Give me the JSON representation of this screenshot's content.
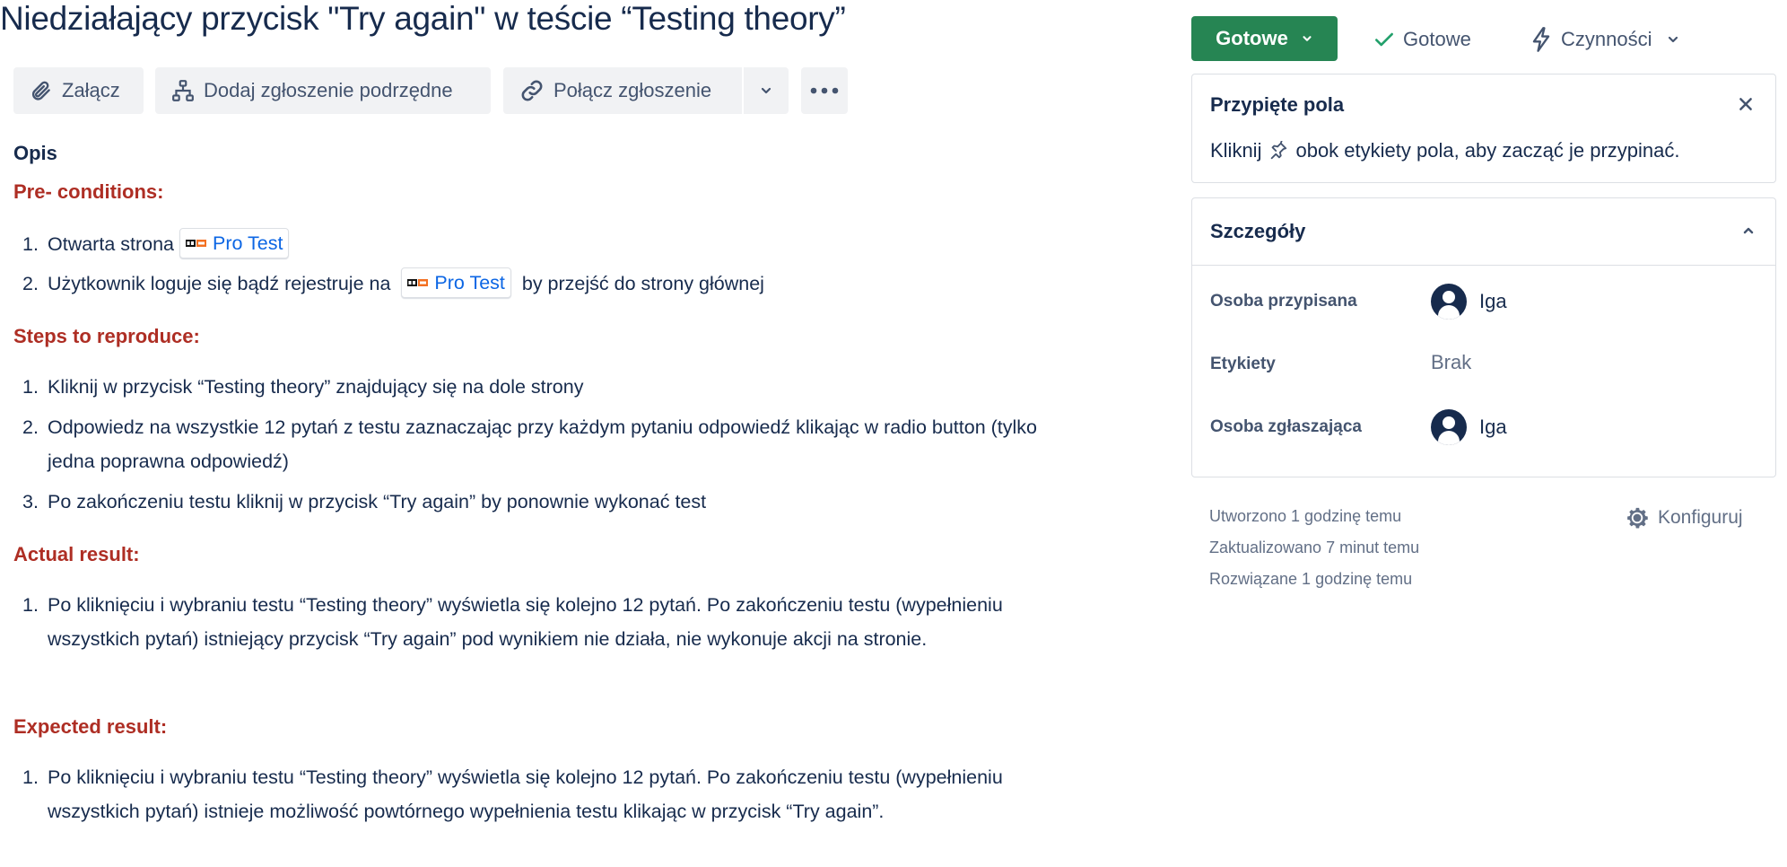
{
  "issue": {
    "title": "Niedziałający przycisk \"Try again\" w teście “Testing theory”"
  },
  "toolbar": {
    "attach_label": "Załącz",
    "add_child_label": "Dodaj zgłoszenie podrzędne",
    "link_issue_label": "Połącz zgłoszenie"
  },
  "description": {
    "heading": "Opis",
    "preconditions": {
      "heading": "Pre- conditions:",
      "items": [
        {
          "num": "1.",
          "before": "Otwarta strona",
          "link": "Pro Test",
          "after": ""
        },
        {
          "num": "2.",
          "before": "Użytkownik loguje się bądź rejestruje na",
          "link": "Pro Test",
          "after": "by przejść do strony głównej"
        }
      ]
    },
    "steps": {
      "heading": "Steps to reproduce:",
      "items": [
        {
          "num": "1.",
          "text": "Kliknij w przycisk “Testing theory” znajdujący się na dole strony"
        },
        {
          "num": "2.",
          "text": "Odpowiedz na wszystkie 12 pytań z testu zaznaczając przy każdym pytaniu odpowiedź klikając w radio button (tylko jedna poprawna odpowiedź)"
        },
        {
          "num": "3.",
          "text": "Po zakończeniu testu kliknij w przycisk “Try again” by ponownie wykonać test"
        }
      ]
    },
    "actual": {
      "heading": "Actual result:",
      "items": [
        {
          "num": "1.",
          "text": "Po kliknięciu i wybraniu testu “Testing theory” wyświetla się kolejno 12 pytań. Po zakończeniu testu (wypełnieniu wszystkich pytań) istniejący przycisk “Try again” pod wynikiem nie działa, nie wykonuje akcji na stronie."
        }
      ]
    },
    "expected": {
      "heading": "Expected result:",
      "items": [
        {
          "num": "1.",
          "text": "Po kliknięciu i wybraniu testu “Testing theory” wyświetla się kolejno 12 pytań. Po zakończeniu testu (wypełnieniu wszystkich pytań) istnieje możliwość powtórnego wypełnienia testu klikając w przycisk “Try again”."
        }
      ]
    }
  },
  "status_bar": {
    "status_button": "Gotowe",
    "resolution": "Gotowe",
    "actions": "Czynności"
  },
  "pinned": {
    "title": "Przypięte pola",
    "hint_before": "Kliknij",
    "hint_after": "obok etykiety pola, aby zacząć je przypinać."
  },
  "details": {
    "title": "Szczegóły",
    "fields": [
      {
        "label": "Osoba przypisana",
        "value": "Iga"
      },
      {
        "label": "Etykiety",
        "value": "Brak"
      },
      {
        "label": "Osoba zgłaszająca",
        "value": "Iga"
      }
    ]
  },
  "meta": {
    "created": "Utworzono 1 godzinę temu",
    "updated": "Zaktualizowano 7 minut temu",
    "resolved": "Rozwiązane 1 godzinę temu",
    "configure": "Konfiguruj"
  },
  "colors": {
    "status_green": "#268553",
    "heading_red": "#ae2e24",
    "link_blue": "#0c66e4",
    "text_dark": "#172b4d"
  }
}
